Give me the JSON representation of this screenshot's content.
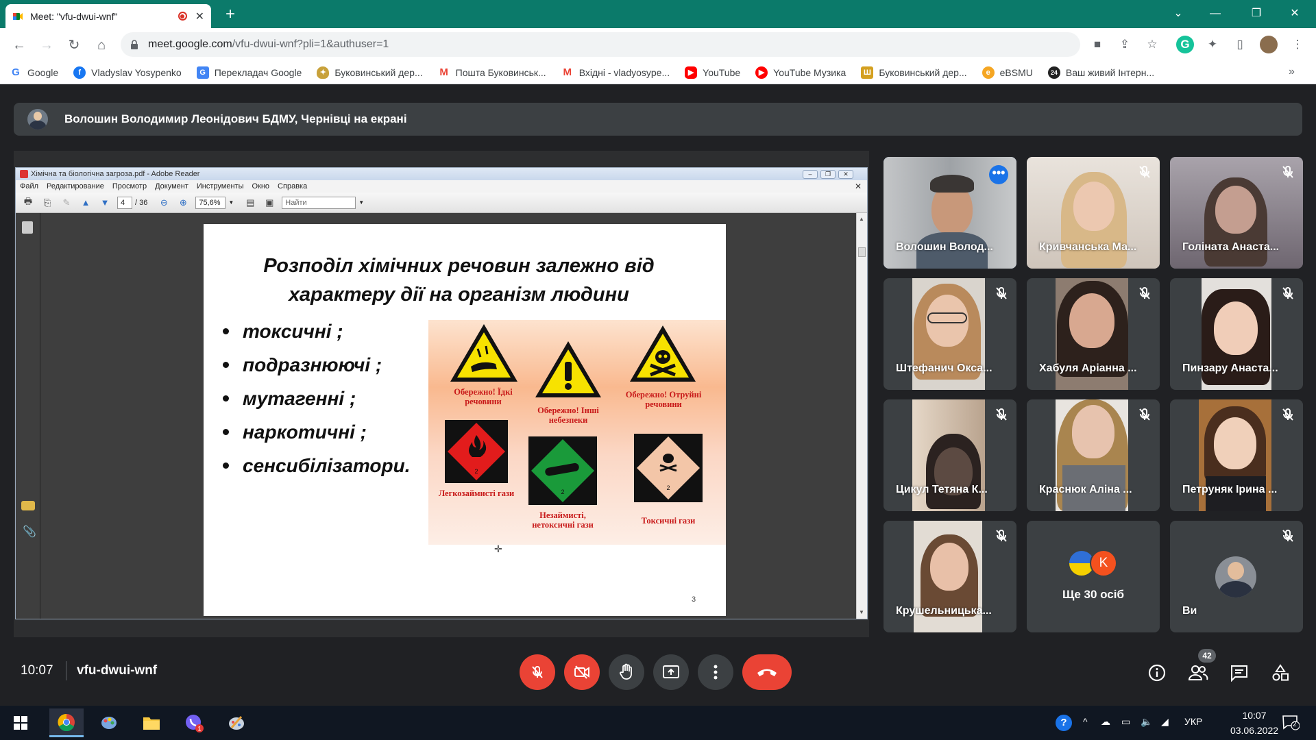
{
  "browser": {
    "tab_title": "Meet: \"vfu-dwui-wnf\"",
    "url_host": "meet.google.com",
    "url_path": "/vfu-dwui-wnf?pli=1&authuser=1",
    "new_tab_label": "+",
    "bookmarks": [
      {
        "label": "Google",
        "icon": "google-icon",
        "color": "#4285f4"
      },
      {
        "label": "Vladyslav Yosypenko",
        "icon": "facebook-icon",
        "color": "#1877f2"
      },
      {
        "label": "Перекладач Google",
        "icon": "translate-icon",
        "color": "#4285f4"
      },
      {
        "label": "Буковинський дер...",
        "icon": "crest-icon",
        "color": "#c8a13a"
      },
      {
        "label": "Пошта Буковинськ...",
        "icon": "gmail-icon",
        "color": "#ea4335"
      },
      {
        "label": "Вхідні - vladyosype...",
        "icon": "gmail-icon",
        "color": "#ea4335"
      },
      {
        "label": "YouTube",
        "icon": "youtube-icon",
        "color": "#ff0000"
      },
      {
        "label": "YouTube Музика",
        "icon": "youtube-music-icon",
        "color": "#ff0000"
      },
      {
        "label": "Буковинський дер...",
        "icon": "university-icon",
        "color": "#d4a020"
      },
      {
        "label": "eBSMU",
        "icon": "ebsmu-icon",
        "color": "#f5a623"
      },
      {
        "label": "Ваш живий Інтерн...",
        "icon": "news24-icon",
        "color": "#222222"
      }
    ]
  },
  "meet": {
    "presenter_banner": "Волошин Володимир Леонідович БДМУ, Чернівці на екрані",
    "clock": "10:07",
    "meeting_code": "vfu-dwui-wnf",
    "participants_count": "42",
    "participants": [
      {
        "name": "Волошин Волод...",
        "muted": false,
        "active": true
      },
      {
        "name": "Кривчанська Ма...",
        "muted": true
      },
      {
        "name": "Голіната Анаста...",
        "muted": true
      },
      {
        "name": "Штефанич Окса...",
        "muted": true
      },
      {
        "name": "Хабуля Аріанна ...",
        "muted": true
      },
      {
        "name": "Пинзару Анаста...",
        "muted": true
      },
      {
        "name": "Цикул Тетяна К...",
        "muted": true
      },
      {
        "name": "Краснюк Аліна ...",
        "muted": true
      },
      {
        "name": "Петруняк Ірина ...",
        "muted": true
      },
      {
        "name": "Крушельницька...",
        "muted": true
      },
      {
        "name": "Ще 30 осіб",
        "avatar_letter": "K"
      },
      {
        "name": "Ви",
        "muted": true
      }
    ]
  },
  "reader": {
    "window_title": "Хімічна та біологічна загроза.pdf - Adobe Reader",
    "menu": [
      "Файл",
      "Редактирование",
      "Просмотр",
      "Документ",
      "Инструменты",
      "Окно",
      "Справка"
    ],
    "page_current": "4",
    "page_total": "/ 36",
    "zoom": "75,6%",
    "search_placeholder": "Найти"
  },
  "slide": {
    "title_line1": "Розподіл хімічних речовин залежно від",
    "title_line2": "характеру дії на організм людини",
    "bullets": [
      "токсичні ;",
      "подразнюючі ;",
      "мутагенні ;",
      "наркотичні ;",
      "сенсибілізатори."
    ],
    "hazard_labels": {
      "corrosive": "Обережно! Їдкі речовини",
      "other": "Обережно! Інші небезпеки",
      "toxic": "Обережно! Отруйні речовини",
      "flammable_gas": "Легкозаймисті гази",
      "nonflammable_gas": "Незаймисті, нетоксичні гази",
      "toxic_gas": "Токсичні гази"
    },
    "page_number": "3"
  },
  "taskbar": {
    "lang": "УКР",
    "time": "10:07",
    "date": "03.06.2022",
    "notifications": "2",
    "viber_badge": "1"
  },
  "colors": {
    "browser_frame": "#0b7a6a",
    "meet_bg": "#202124",
    "tile_bg": "#3c4043",
    "danger": "#ea4335",
    "accent": "#1a73e8"
  }
}
